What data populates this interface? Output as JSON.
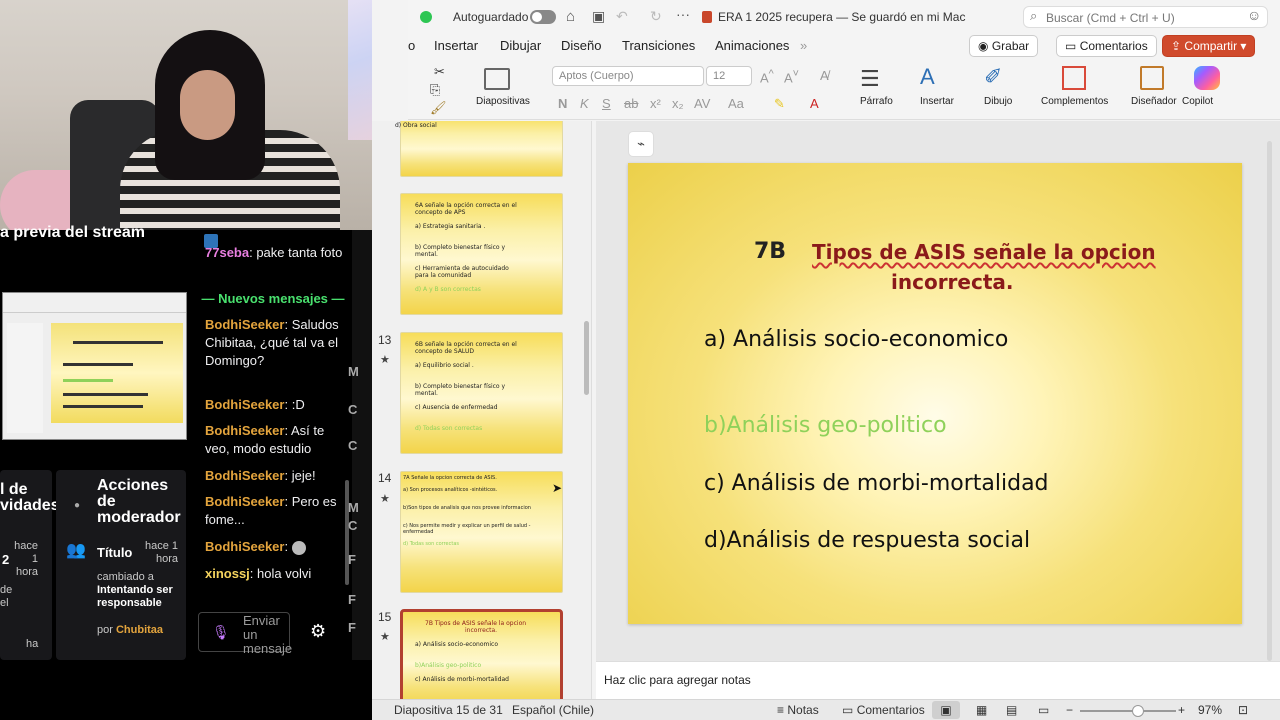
{
  "stream": {
    "preview_title": "a previa del stream",
    "new_messages_label": "— Nuevos mensajes —",
    "messages": [
      {
        "user": "77seba",
        "text": ": pake tanta foto",
        "user_color": "#e87fe0"
      },
      {
        "user": "BodhiSeeker",
        "text": ": Saludos Chibitaa, ¿qué tal va el Domingo?"
      },
      {
        "user": "BodhiSeeker",
        "text": ": :D"
      },
      {
        "user": "BodhiSeeker",
        "text": ": Así te veo, modo estudio"
      },
      {
        "user": "BodhiSeeker",
        "text": ": jeje!"
      },
      {
        "user": "BodhiSeeker",
        "text": ": Pero es fome..."
      },
      {
        "user": "BodhiSeeker",
        "text": ":"
      },
      {
        "user": "xinossj",
        "text": ": hola volvi",
        "user_color": "#f4d35e"
      }
    ],
    "chat_placeholder": "Enviar un mensaje",
    "activity_title_partial": "l de\nvidades",
    "mod_actions_title": "Acciones de moderador",
    "mod_item_title": "Título",
    "mod_item_time": "hace 1 hora",
    "mod_item_desc_1": "cambiado a",
    "mod_item_desc_2": "Intentando ser responsable",
    "mod_item_by": "por",
    "mod_item_by_user": "Chubitaa",
    "left_col_time": "hace 1 hora",
    "left_col_num": "2",
    "left_col_letters": "de el",
    "left_col_bottom": "ha",
    "right_strip_letters": [
      "M",
      "C",
      "C",
      "M",
      "C",
      "F",
      "F",
      "F"
    ]
  },
  "ppt": {
    "autosave_label": "Autoguardado",
    "doc_title": "ERA 1 2025 recupera — Se guardó en mi Mac",
    "search_placeholder": "Buscar (Cmd + Ctrl + U)",
    "menu": [
      "o",
      "Insertar",
      "Dibujar",
      "Diseño",
      "Transiciones",
      "Animaciones"
    ],
    "record_label": "Grabar",
    "comments_label": "Comentarios",
    "share_label": "Compartir",
    "ribbon": {
      "slides_label": "Diapositivas",
      "font_name": "Aptos (Cuerpo)",
      "font_size": "12",
      "paragraph_label": "Párrafo",
      "insert_label": "Insertar",
      "draw_label": "Dibujo",
      "addins_label": "Complementos",
      "designer_label": "Diseñador",
      "copilot_label": "Copilot"
    },
    "thumbnails": [
      {
        "num": "",
        "lines": [
          "d) Obra social"
        ]
      },
      {
        "num": "",
        "lines": [
          "6A   señale la opción correcta en el",
          "concepto de APS",
          "",
          "a) Estrategia sanitaria .",
          "",
          "",
          "b) Completo bienestar físico y",
          "mental.",
          "",
          "c) Herramienta de autocuidado",
          "para la comunidad",
          "",
          "d) A y B son  correctas"
        ]
      },
      {
        "num": "13",
        "lines": [
          "6B   señale la opción correcta en el",
          "concepto de SALUD",
          "",
          "a) Equilibrio social .",
          "",
          "",
          "b) Completo bienestar físico y",
          "mental.",
          "",
          "c) Ausencia de enfermedad",
          "",
          "",
          "d)  Todas son correctas"
        ]
      },
      {
        "num": "14",
        "lines": [
          "7A   Señale la opcion correcta de ASIS.",
          "",
          "a) Son procesos analíticos -sintéticos.",
          "",
          "",
          "b)Son  tipos de analisis que nos provee informacion",
          "",
          "",
          "c) Nos permite medir y explicar un perfil de salud -",
          "enfermedad",
          "",
          "d)  Todas son correctas"
        ]
      },
      {
        "num": "15",
        "lines": [
          "7B    Tipos de ASIS señale la opcion",
          "incorrecta.",
          "",
          "a) Análisis socio-economico",
          "",
          "",
          "b)Análisis geo-politico",
          "",
          "c) Análisis de morbi-mortalidad"
        ]
      }
    ],
    "slide": {
      "number_label": "7B",
      "title_line1": "Tipos de ASIS señale la opcion",
      "title_line2": "incorrecta.",
      "option_a": "a) Análisis socio-economico",
      "option_b": "b)Análisis geo-politico",
      "option_c": "c) Análisis de morbi-mortalidad",
      "option_d": "d)Análisis de respuesta social",
      "title_color": "#8b1a1a",
      "highlight_color": "#8fd15a"
    },
    "notes_placeholder": "Haz clic para agregar notas",
    "status": {
      "slide_position": "Diapositiva 15 de 31",
      "language": "Español (Chile)",
      "notes_label": "Notas",
      "comments_label": "Comentarios",
      "zoom": "97%",
      "zoom_fraction": 0.6
    }
  }
}
